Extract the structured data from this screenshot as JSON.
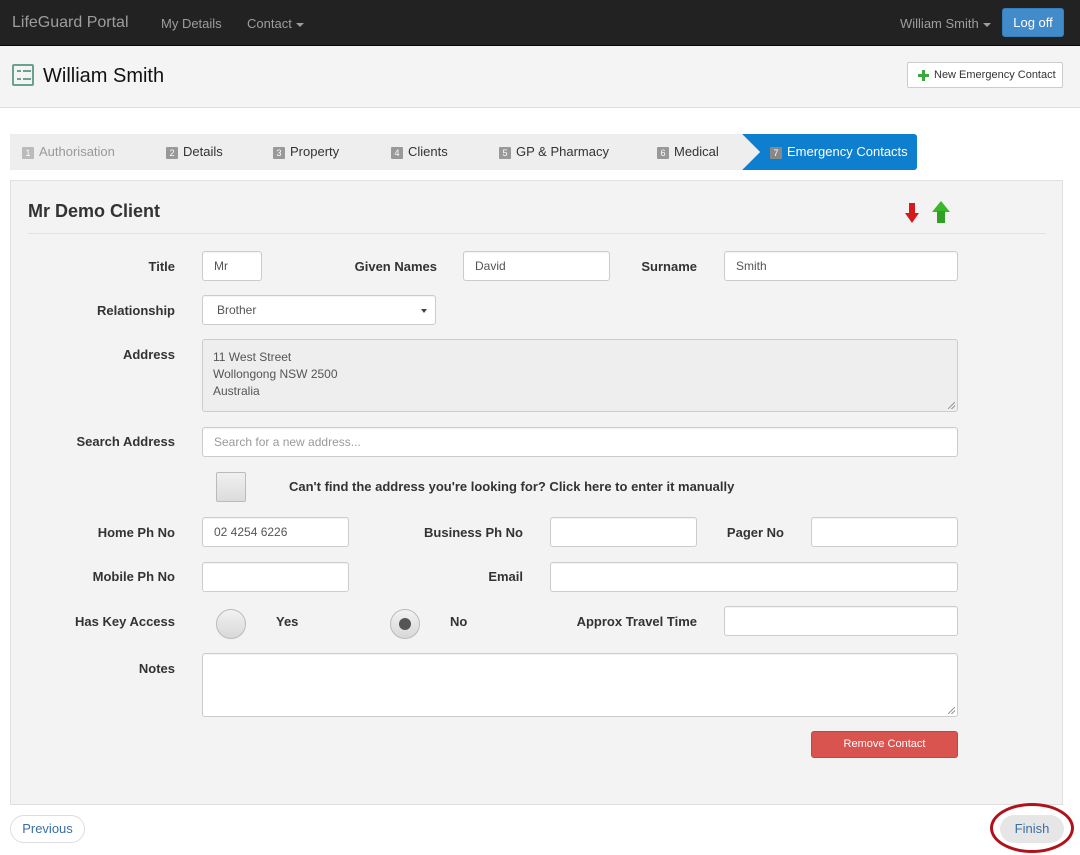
{
  "navbar": {
    "brand": "LifeGuard Portal",
    "links": [
      {
        "label": "My Details",
        "dropdown": false
      },
      {
        "label": "Contact",
        "dropdown": true
      }
    ],
    "user_menu": "William Smith",
    "logoff_label": "Log off",
    "accent_color": "#428bca"
  },
  "header": {
    "icon": "checklist-icon",
    "title": "William Smith",
    "new_contact_label": "New Emergency Contact"
  },
  "wizard": {
    "steps": [
      {
        "number": "1",
        "label": "Authorisation",
        "state": "disabled"
      },
      {
        "number": "2",
        "label": "Details",
        "state": "default"
      },
      {
        "number": "3",
        "label": "Property",
        "state": "default"
      },
      {
        "number": "4",
        "label": "Clients",
        "state": "default"
      },
      {
        "number": "5",
        "label": "GP & Pharmacy",
        "state": "default"
      },
      {
        "number": "6",
        "label": "Medical",
        "state": "default"
      },
      {
        "number": "7",
        "label": "Emergency Contacts",
        "state": "active"
      }
    ],
    "active_color": "#0e7ecf"
  },
  "contact": {
    "heading": "Mr Demo Client",
    "move_down_icon": "arrow-down-icon",
    "move_up_icon": "arrow-up-icon",
    "fields": {
      "title": {
        "label": "Title",
        "value": "Mr"
      },
      "given_names": {
        "label": "Given Names",
        "value": "David"
      },
      "surname": {
        "label": "Surname",
        "value": "Smith"
      },
      "relationship": {
        "label": "Relationship",
        "value": "Brother"
      },
      "address": {
        "label": "Address",
        "lines": [
          "11 West Street",
          "Wollongong NSW 2500",
          "Australia"
        ]
      },
      "search_address": {
        "label": "Search Address",
        "value": "",
        "placeholder": "Search for a new address..."
      },
      "manual_entry": {
        "label": "Can't find the address you're looking for? Click here to enter it manually",
        "checked": false
      },
      "home_ph": {
        "label": "Home Ph No",
        "value": "02 4254 6226"
      },
      "business_ph": {
        "label": "Business Ph No",
        "value": ""
      },
      "pager": {
        "label": "Pager No",
        "value": ""
      },
      "mobile_ph": {
        "label": "Mobile Ph No",
        "value": ""
      },
      "email": {
        "label": "Email",
        "value": ""
      },
      "key_access": {
        "label": "Has Key Access",
        "options": [
          "Yes",
          "No"
        ],
        "selected": "No"
      },
      "travel_time": {
        "label": "Approx Travel Time",
        "value": ""
      },
      "notes": {
        "label": "Notes",
        "value": ""
      }
    },
    "remove_label": "Remove Contact",
    "remove_color": "#d9534f"
  },
  "footer": {
    "previous_label": "Previous",
    "finish_label": "Finish",
    "highlight_color": "#b0121b"
  }
}
